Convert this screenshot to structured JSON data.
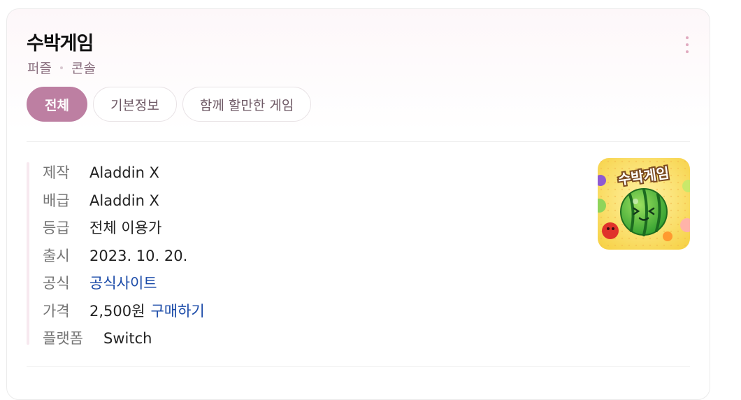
{
  "header": {
    "title": "수박게임",
    "genre": "퍼즐",
    "platform_type": "콘솔"
  },
  "tabs": [
    {
      "label": "전체",
      "active": true
    },
    {
      "label": "기본정보",
      "active": false
    },
    {
      "label": "함께 할만한 게임",
      "active": false
    }
  ],
  "info": {
    "developer": {
      "label": "제작",
      "value": "Aladdin X"
    },
    "publisher": {
      "label": "배급",
      "value": "Aladdin X"
    },
    "rating": {
      "label": "등급",
      "value": "전체 이용가"
    },
    "release": {
      "label": "출시",
      "value": "2023. 10. 20."
    },
    "official": {
      "label": "공식",
      "link": "공식사이트"
    },
    "price": {
      "label": "가격",
      "value": "2,500원",
      "link": "구매하기"
    },
    "platform": {
      "label": "플랫폼",
      "value": "Switch"
    }
  },
  "thumbnail": {
    "caption": "수박게임"
  },
  "colors": {
    "accent": "#bd7fa2",
    "link": "#1a4aa8",
    "muted": "#8a6f7f"
  },
  "icons": {
    "more": "more-vertical-icon"
  }
}
